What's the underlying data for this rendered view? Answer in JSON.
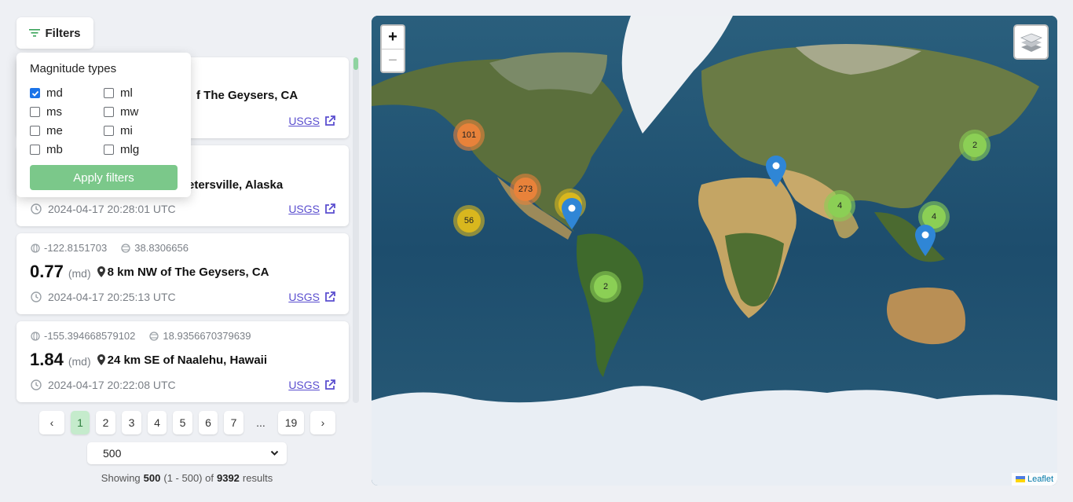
{
  "filters_button": {
    "label": "Filters"
  },
  "filter_panel": {
    "title": "Magnitude types",
    "options": [
      {
        "label": "md",
        "checked": true
      },
      {
        "label": "ml",
        "checked": false
      },
      {
        "label": "ms",
        "checked": false
      },
      {
        "label": "mw",
        "checked": false
      },
      {
        "label": "me",
        "checked": false
      },
      {
        "label": "mi",
        "checked": false
      },
      {
        "label": "mb",
        "checked": false
      },
      {
        "label": "mlg",
        "checked": false
      }
    ],
    "apply_label": "Apply filters"
  },
  "events": [
    {
      "lon": "",
      "lat": "",
      "mag": "",
      "magtype": "",
      "place": "f The Geysers, CA",
      "time": "",
      "link": "USGS"
    },
    {
      "lon": "",
      "lat": "",
      "mag": "",
      "magtype": "",
      "place": "Petersville, Alaska",
      "time": "2024-04-17 20:28:01 UTC",
      "link": "USGS"
    },
    {
      "lon": "-122.8151703",
      "lat": "38.8306656",
      "mag": "0.77",
      "magtype": "(md)",
      "place": "8 km NW of The Geysers, CA",
      "time": "2024-04-17 20:25:13 UTC",
      "link": "USGS"
    },
    {
      "lon": "-155.394668579102",
      "lat": "18.9356670379639",
      "mag": "1.84",
      "magtype": "(md)",
      "place": "24 km SE of Naalehu, Hawaii",
      "time": "2024-04-17 20:22:08 UTC",
      "link": "USGS"
    }
  ],
  "pagination": {
    "prev": "‹",
    "pages": [
      "1",
      "2",
      "3",
      "4",
      "5",
      "6",
      "7"
    ],
    "dots": "...",
    "last": "19",
    "next": "›",
    "active": "1"
  },
  "per_page": {
    "value": "500"
  },
  "summary": {
    "prefix": "Showing",
    "count": "500",
    "range": "(1 - 500)",
    "of": "of",
    "total": "9392",
    "suffix": "results"
  },
  "map": {
    "zoom_in": "+",
    "zoom_out": "−",
    "attribution": "Leaflet",
    "clusters": [
      {
        "label": "101",
        "color": "#e8823a"
      },
      {
        "label": "273",
        "color": "#e8823a"
      },
      {
        "label": "56",
        "color": "#d9b71e"
      },
      {
        "label": "2",
        "color": "#8bcf55"
      },
      {
        "label": "2",
        "color": "#8bcf55"
      },
      {
        "label": "4",
        "color": "#8bcf55"
      },
      {
        "label": "4",
        "color": "#8bcf55"
      }
    ],
    "marker_color": "#2f86d6"
  }
}
